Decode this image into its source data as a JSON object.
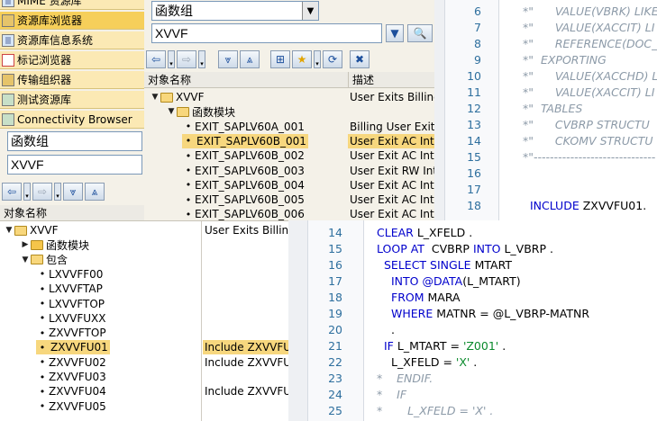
{
  "top_left": {
    "nav_items": [
      {
        "label": "MIME 资源库",
        "icon": "book-icon"
      },
      {
        "label": "资源库浏览器",
        "icon": "repository-browser-icon",
        "selected": true
      },
      {
        "label": "资源库信息系统",
        "icon": "info-system-icon"
      },
      {
        "label": "标记浏览器",
        "icon": "tag-browser-icon"
      },
      {
        "label": "传输组织器",
        "icon": "transport-organizer-icon"
      },
      {
        "label": "测试资源库",
        "icon": "test-repository-icon"
      },
      {
        "label": "Connectivity Browser",
        "icon": "connectivity-icon"
      }
    ],
    "object_type": "函数组",
    "object_name": "XVVF",
    "tree_header": "对象名称"
  },
  "top_middle": {
    "object_type": "函数组",
    "object_name": "XVVF",
    "headers": {
      "name": "对象名称",
      "desc": "描述"
    },
    "rows": [
      {
        "name": "XVVF",
        "desc": "User Exits Billing",
        "level": 0,
        "kind": "folder-open"
      },
      {
        "name": "函数模块",
        "desc": "",
        "level": 1,
        "kind": "folder-open"
      },
      {
        "name": "EXIT_SAPLV60A_001",
        "desc": "Billing User Exit.",
        "level": 2,
        "kind": "leaf"
      },
      {
        "name": "EXIT_SAPLV60B_001",
        "desc": "User Exit AC Inte",
        "level": 2,
        "kind": "leaf",
        "selected": true
      },
      {
        "name": "EXIT_SAPLV60B_002",
        "desc": "User Exit AC Inte",
        "level": 2,
        "kind": "leaf"
      },
      {
        "name": "EXIT_SAPLV60B_003",
        "desc": "User Exit RW Int",
        "level": 2,
        "kind": "leaf"
      },
      {
        "name": "EXIT_SAPLV60B_004",
        "desc": "User Exit AC Inte",
        "level": 2,
        "kind": "leaf"
      },
      {
        "name": "EXIT_SAPLV60B_005",
        "desc": "User Exit AC Inte",
        "level": 2,
        "kind": "leaf"
      },
      {
        "name": "EXIT_SAPLV60B_006",
        "desc": "User Exit AC Inte",
        "level": 2,
        "kind": "leaf"
      }
    ]
  },
  "top_code": {
    "lines": [
      {
        "n": "6",
        "text": "*\"      VALUE(VBRK) LIKE"
      },
      {
        "n": "7",
        "text": "*\"      VALUE(XACCIT) LI"
      },
      {
        "n": "8",
        "text": "*\"      REFERENCE(DOC_"
      },
      {
        "n": "9",
        "text": "*\"  EXPORTING"
      },
      {
        "n": "10",
        "text": "*\"      VALUE(XACCHD) LI"
      },
      {
        "n": "11",
        "text": "*\"      VALUE(XACCIT) LI"
      },
      {
        "n": "12",
        "text": "*\"  TABLES"
      },
      {
        "n": "13",
        "text": "*\"      CVBRP STRUCTU"
      },
      {
        "n": "14",
        "text": "*\"      CKOMV STRUCTU"
      },
      {
        "n": "15",
        "text": "*\"------------------------------"
      },
      {
        "n": "16",
        "text": ""
      },
      {
        "n": "17",
        "text": ""
      },
      {
        "n": "18",
        "text": "  INCLUDE ZXVVFU01."
      }
    ]
  },
  "bottom_tree": {
    "rows": [
      {
        "name": "XVVF",
        "desc": "User Exits Billing",
        "kind": "folder-open",
        "level": 0
      },
      {
        "name": "函数模块",
        "desc": "",
        "kind": "folder-closed",
        "level": 1
      },
      {
        "name": "包含",
        "desc": "",
        "kind": "folder-open",
        "level": 1
      },
      {
        "name": "LXVVFF00",
        "desc": "",
        "kind": "leaf",
        "level": 2
      },
      {
        "name": "LXVVFTAP",
        "desc": "",
        "kind": "leaf",
        "level": 2
      },
      {
        "name": "LXVVFTOP",
        "desc": "",
        "kind": "leaf",
        "level": 2
      },
      {
        "name": "LXVVFUXX",
        "desc": "",
        "kind": "leaf",
        "level": 2
      },
      {
        "name": "ZXVVFTOP",
        "desc": "",
        "kind": "leaf",
        "level": 2
      },
      {
        "name": "ZXVVFU01",
        "desc": "Include ZXVVFU0",
        "kind": "leaf",
        "level": 2,
        "selected": true
      },
      {
        "name": "ZXVVFU02",
        "desc": "Include ZXVVFU0",
        "kind": "leaf",
        "level": 2
      },
      {
        "name": "ZXVVFU03",
        "desc": "",
        "kind": "leaf",
        "level": 2
      },
      {
        "name": "ZXVVFU04",
        "desc": "Include ZXVVFU0",
        "kind": "leaf",
        "level": 2
      },
      {
        "name": "ZXVVFU05",
        "desc": "",
        "kind": "leaf",
        "level": 2
      }
    ]
  },
  "bottom_code": {
    "lines": [
      {
        "n": "14",
        "text": "CLEAR L_XFELD ."
      },
      {
        "n": "15",
        "text": "LOOP AT  CVBRP INTO L_VBRP ."
      },
      {
        "n": "16",
        "text": "SELECT SINGLE MTART"
      },
      {
        "n": "17",
        "text": "INTO @DATA(L_MTART)"
      },
      {
        "n": "18",
        "text": "FROM MARA"
      },
      {
        "n": "19",
        "text": "WHERE MATNR = @L_VBRP-MATNR"
      },
      {
        "n": "20",
        "text": "."
      },
      {
        "n": "21",
        "text": "IF L_MTART = 'Z001' ."
      },
      {
        "n": "22",
        "text": "L_XFELD = 'X' ."
      },
      {
        "n": "23",
        "text": "*    ENDIF."
      },
      {
        "n": "24",
        "text": "*    IF"
      },
      {
        "n": "25",
        "text": "*       L_XFELD = 'X' ."
      }
    ]
  }
}
